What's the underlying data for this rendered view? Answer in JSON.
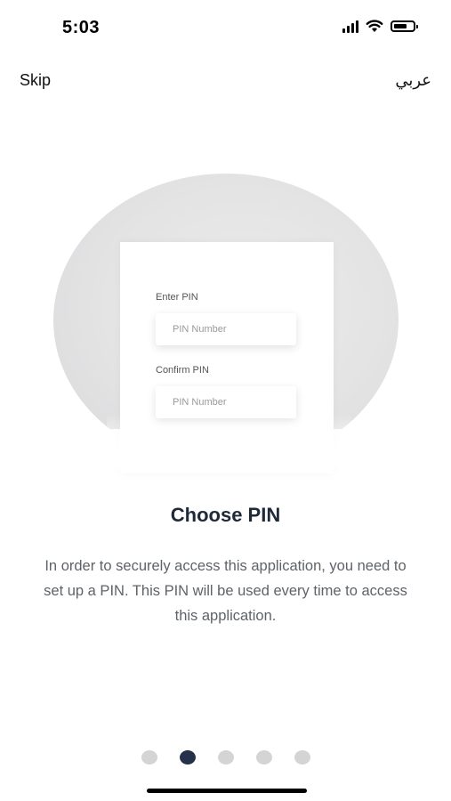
{
  "status_bar": {
    "time": "5:03",
    "icons": [
      "signal-icon",
      "wifi-icon",
      "battery-icon"
    ]
  },
  "header": {
    "skip_label": "Skip",
    "language_label": "عربي"
  },
  "illustration": {
    "enter_pin_label": "Enter PIN",
    "enter_pin_placeholder": "PIN Number",
    "confirm_pin_label": "Confirm PIN",
    "confirm_pin_placeholder": "PIN Number"
  },
  "content": {
    "title": "Choose PIN",
    "description": "In order to securely access this application, you need to set up a PIN. This PIN will be used every time to access this application."
  },
  "pagination": {
    "total": 5,
    "active_index": 1
  },
  "colors": {
    "title": "#1f2937",
    "description": "#5f6368",
    "dot_active": "#25314a",
    "dot_inactive": "#d4d4d4",
    "illustration_bg": "#e3e3e4"
  }
}
